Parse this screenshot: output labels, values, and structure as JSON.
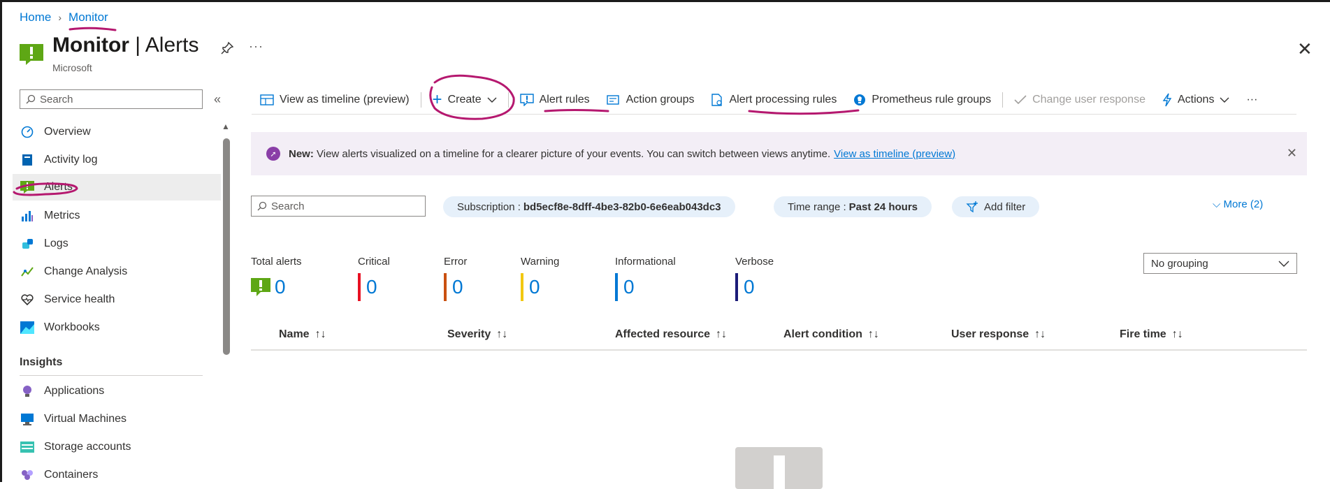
{
  "breadcrumb": {
    "home": "Home",
    "separator": "›",
    "current": "Monitor"
  },
  "header": {
    "title_bold": "Monitor",
    "title_rest": " | Alerts",
    "subtitle": "Microsoft",
    "more": "···",
    "close": "✕"
  },
  "sidebar": {
    "search_placeholder": "Search",
    "collapse": "«",
    "items": [
      {
        "label": "Overview",
        "icon": "gauge-icon"
      },
      {
        "label": "Activity log",
        "icon": "book-icon"
      },
      {
        "label": "Alerts",
        "icon": "alert-icon",
        "active": true
      },
      {
        "label": "Metrics",
        "icon": "metrics-icon"
      },
      {
        "label": "Logs",
        "icon": "logs-icon"
      },
      {
        "label": "Change Analysis",
        "icon": "change-analysis-icon"
      },
      {
        "label": "Service health",
        "icon": "heart-icon"
      },
      {
        "label": "Workbooks",
        "icon": "workbooks-icon"
      }
    ],
    "section": "Insights",
    "insights": [
      {
        "label": "Applications",
        "icon": "bulb-icon"
      },
      {
        "label": "Virtual Machines",
        "icon": "vm-icon"
      },
      {
        "label": "Storage accounts",
        "icon": "storage-icon"
      },
      {
        "label": "Containers",
        "icon": "containers-icon"
      }
    ]
  },
  "toolbar": {
    "view_timeline": "View as timeline (preview)",
    "create": "Create",
    "alert_rules": "Alert rules",
    "action_groups": "Action groups",
    "alert_processing_rules": "Alert processing rules",
    "prometheus": "Prometheus rule groups",
    "change_user_response": "Change user response",
    "actions": "Actions",
    "more": "···"
  },
  "banner": {
    "new_label": "New:",
    "text": "View alerts visualized on a timeline for a clearer picture of your events. You can switch between views anytime.",
    "link": "View as timeline (preview)",
    "close": "✕"
  },
  "filters": {
    "search_placeholder": "Search",
    "subscription_label": "Subscription :",
    "subscription_value": "bd5ecf8e-8dff-4be3-82b0-6e6eab043dc3",
    "time_range_label": "Time range :",
    "time_range_value": "Past 24 hours",
    "add_filter": "Add filter",
    "more": "More (2)"
  },
  "stats": {
    "total": {
      "label": "Total alerts",
      "value": "0"
    },
    "critical": {
      "label": "Critical",
      "value": "0",
      "color": "#e81123"
    },
    "error": {
      "label": "Error",
      "value": "0",
      "color": "#ca5010"
    },
    "warning": {
      "label": "Warning",
      "value": "0",
      "color": "#f2c811"
    },
    "informational": {
      "label": "Informational",
      "value": "0",
      "color": "#0078d4"
    },
    "verbose": {
      "label": "Verbose",
      "value": "0",
      "color": "#1b1b78"
    }
  },
  "grouping": {
    "value": "No grouping"
  },
  "table": {
    "columns": [
      "Name",
      "Severity",
      "Affected resource",
      "Alert condition",
      "User response",
      "Fire time"
    ],
    "sort_glyph": "↑↓"
  },
  "colors": {
    "accent": "#0078d4",
    "annotation": "#b5186f",
    "alert_green": "#5ea715"
  }
}
